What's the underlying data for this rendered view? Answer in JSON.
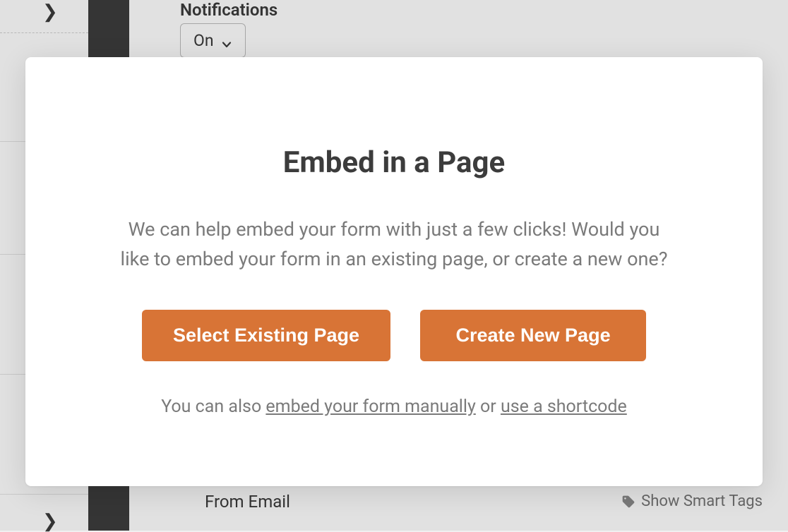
{
  "background": {
    "notifications_label": "Notifications",
    "notifications_value": "On",
    "from_email_label": "From Email",
    "smart_tags_label": "Show Smart Tags"
  },
  "modal": {
    "title": "Embed in a Page",
    "body": "We can help embed your form with just a few clicks! Would you like to embed your form in an existing page, or create a new one?",
    "select_existing_label": "Select Existing Page",
    "create_new_label": "Create New Page",
    "footer_prefix": "You can also ",
    "footer_link_manual": "embed your form manually",
    "footer_or": " or ",
    "footer_link_shortcode": "use a shortcode"
  },
  "colors": {
    "accent": "#d87436"
  }
}
